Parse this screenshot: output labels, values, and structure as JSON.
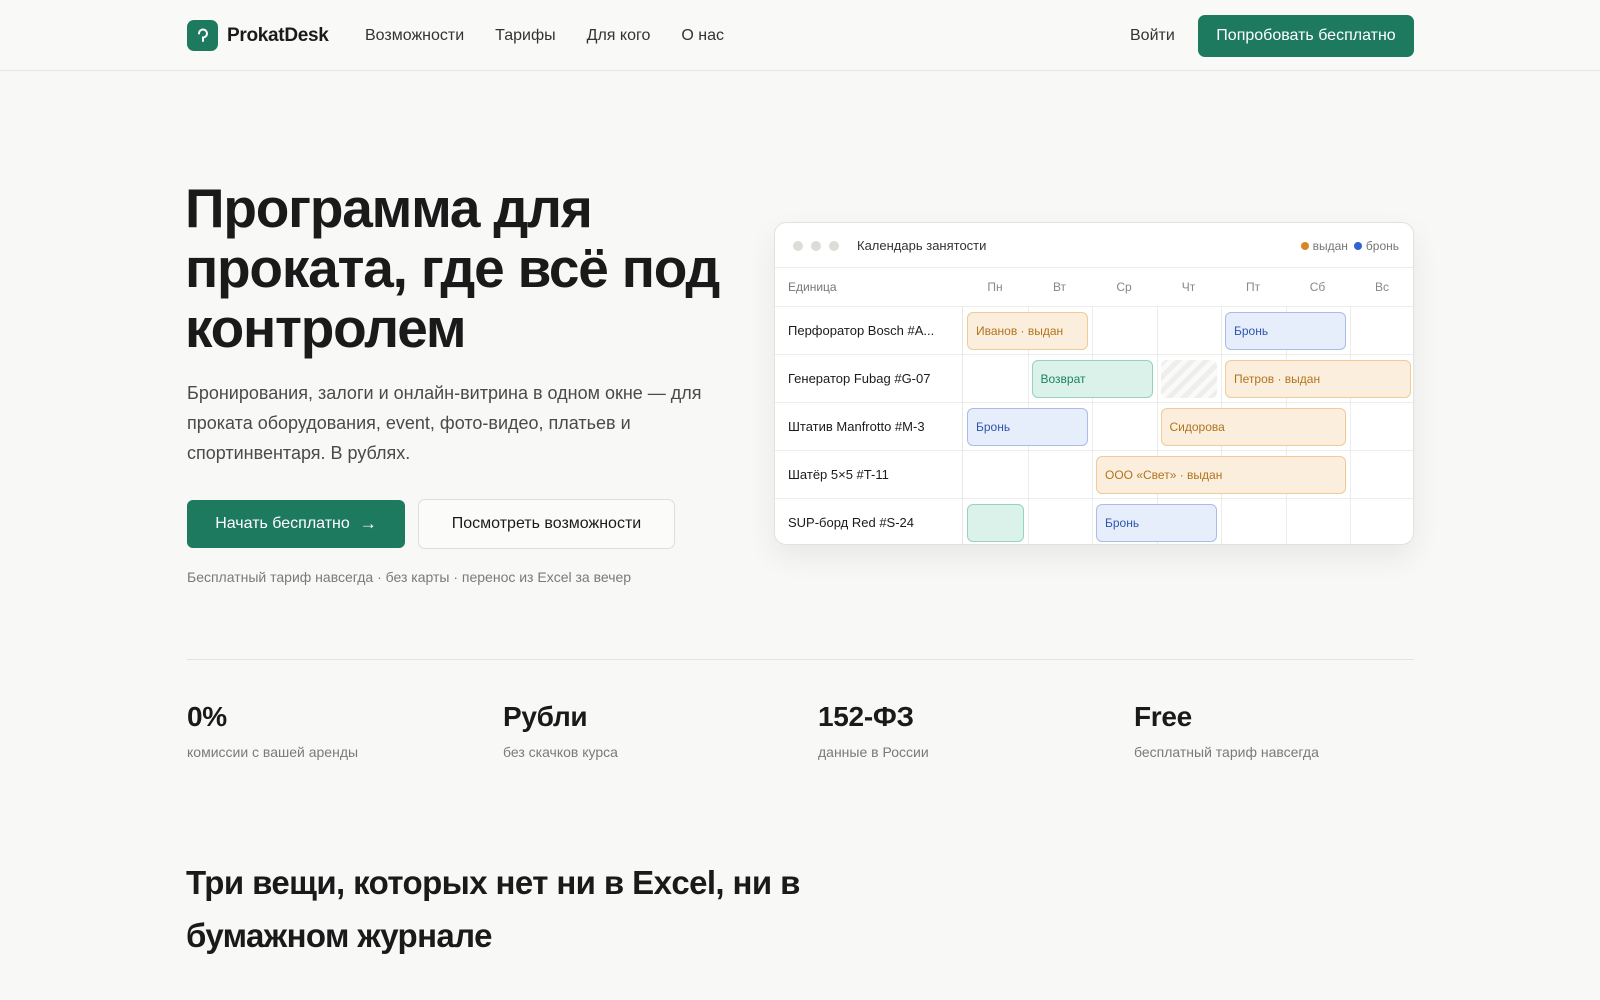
{
  "nav": {
    "brand": "ProkatDesk",
    "links": [
      "Возможности",
      "Тарифы",
      "Для кого",
      "О нас"
    ],
    "login": "Войти",
    "cta": "Попробовать бесплатно"
  },
  "hero": {
    "title": "Программа для проката, где всё под контролем",
    "subtitle": "Бронирования, залоги и онлайн-витрина в одном окне — для проката оборудования, event, фото-видео, платьев и спортинвентаря. В рублях.",
    "primary_button": "Начать бесплатно",
    "secondary_button": "Посмотреть возможности",
    "note": "Бесплатный тариф навсегда · без карты · перенос из Excel за вечер"
  },
  "calendar": {
    "title": "Календарь занятости",
    "legend": [
      {
        "label": "выдан",
        "color": "#d98521"
      },
      {
        "label": "бронь",
        "color": "#2f62d6"
      }
    ],
    "unit_header": "Единица",
    "days": [
      "Пн",
      "Вт",
      "Ср",
      "Чт",
      "Пт",
      "Сб",
      "Вс"
    ],
    "rows": [
      {
        "label": "Перфоратор Bosch #A...",
        "bars": [
          {
            "start": 0,
            "span": 2,
            "kind": "out",
            "text": "Иванов · выдан"
          },
          {
            "start": 4,
            "span": 2,
            "kind": "book",
            "text": "Бронь"
          }
        ]
      },
      {
        "label": "Генератор Fubag #G-07",
        "bars": [
          {
            "start": 1,
            "span": 2,
            "kind": "ret",
            "text": "Возврат"
          },
          {
            "start": 3,
            "span": 1,
            "kind": "hatch",
            "text": ""
          },
          {
            "start": 4,
            "span": 3,
            "kind": "out",
            "text": "Петров · выдан"
          }
        ]
      },
      {
        "label": "Штатив Manfrotto #M-3",
        "bars": [
          {
            "start": 0,
            "span": 2,
            "kind": "book",
            "text": "Бронь"
          },
          {
            "start": 3,
            "span": 3,
            "kind": "out",
            "text": "Сидорова"
          }
        ]
      },
      {
        "label": "Шатёр 5×5 #T-11",
        "bars": [
          {
            "start": 2,
            "span": 4,
            "kind": "out",
            "text": "ООО «Свет» · выдан"
          }
        ]
      },
      {
        "label": "SUP-борд Red #S-24",
        "bars": [
          {
            "start": 0,
            "span": 1,
            "kind": "ret",
            "text": ""
          },
          {
            "start": 2,
            "span": 2,
            "kind": "book",
            "text": "Бронь"
          }
        ]
      }
    ]
  },
  "stats": [
    {
      "value": "0%",
      "label": "комиссии с вашей аренды"
    },
    {
      "value": "Рубли",
      "label": "без скачков курса"
    },
    {
      "value": "152-ФЗ",
      "label": "данные в России"
    },
    {
      "value": "Free",
      "label": "бесплатный тариф навсегда"
    }
  ],
  "section": {
    "title": "Три вещи, которых нет ни в Excel, ни в бумажном журнале"
  }
}
